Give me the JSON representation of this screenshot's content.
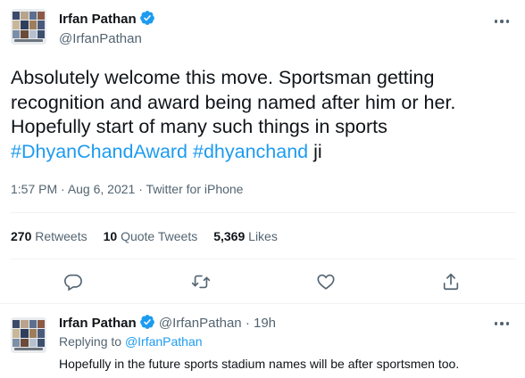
{
  "colors": {
    "accent": "#1d9bf0",
    "text": "#0f1419",
    "muted": "#536471",
    "divider": "#eff3f4"
  },
  "tweet": {
    "author_name": "Irfan Pathan",
    "author_handle": "@IrfanPathan",
    "verified_icon": "verified-badge-icon",
    "body_text": "Absolutely welcome this move. Sportsman getting recognition and award being named after him or her. Hopefully start of many such things in sports",
    "hashtags": [
      "#DhyanChandAward",
      "#dhyanchand"
    ],
    "body_suffix": "ji",
    "time": "1:57 PM",
    "date": "Aug 6, 2021",
    "source": "Twitter for iPhone",
    "stats": [
      {
        "count": "270",
        "label": "Retweets"
      },
      {
        "count": "10",
        "label": "Quote Tweets"
      },
      {
        "count": "5,369",
        "label": "Likes"
      }
    ],
    "actions": [
      "reply-icon",
      "retweet-icon",
      "like-icon",
      "share-icon"
    ]
  },
  "reply": {
    "author_name": "Irfan Pathan",
    "author_handle": "@IrfanPathan",
    "age": "19h",
    "replying_label": "Replying to",
    "replying_handle": "@IrfanPathan",
    "text": "Hopefully in the future sports stadium names will be after sportsmen too."
  }
}
